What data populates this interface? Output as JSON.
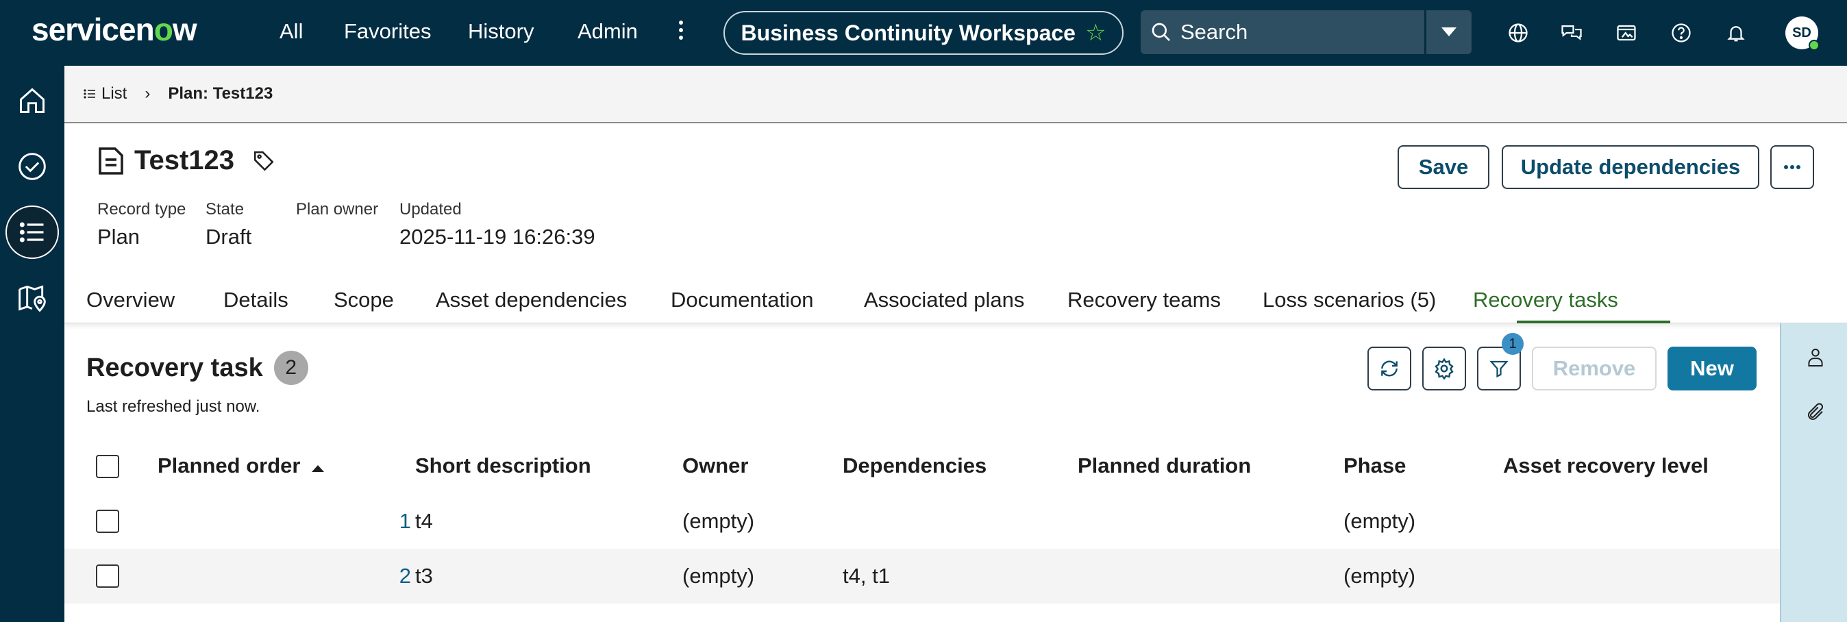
{
  "topbar": {
    "logo_prefix": "servicen",
    "logo_o": "o",
    "logo_suffix": "w",
    "nav": [
      "All",
      "Favorites",
      "History",
      "Admin"
    ],
    "workspace": "Business Continuity Workspace",
    "search_placeholder": "Search",
    "avatar_initials": "SD",
    "icons": [
      "globe-icon",
      "chat-icon",
      "media-icon",
      "help-icon",
      "bell-icon"
    ]
  },
  "rail": {
    "icons": [
      "home-icon",
      "check-circle-icon",
      "list-icon",
      "map-pin-icon"
    ],
    "active": "list-icon"
  },
  "breadcrumb": {
    "list_label": "List",
    "current": "Plan: Test123"
  },
  "record": {
    "title": "Test123",
    "fields": [
      {
        "label": "Record type",
        "value": "Plan"
      },
      {
        "label": "State",
        "value": "Draft"
      },
      {
        "label": "Plan owner",
        "value": ""
      },
      {
        "label": "Updated",
        "value": "2025-11-19 16:26:39"
      }
    ],
    "actions": {
      "save": "Save",
      "update_dependencies": "Update dependencies"
    }
  },
  "tabs": [
    "Overview",
    "Details",
    "Scope",
    "Asset dependencies",
    "Documentation",
    "Associated plans",
    "Recovery teams",
    "Loss scenarios (5)",
    "Recovery tasks"
  ],
  "active_tab": "Recovery tasks",
  "related_list": {
    "title": "Recovery task",
    "count": "2",
    "refreshed": "Last refreshed just now.",
    "filter_count": "1",
    "remove_label": "Remove",
    "new_label": "New",
    "columns": [
      "Planned order",
      "Short description",
      "Owner",
      "Dependencies",
      "Planned duration",
      "Phase",
      "Asset recovery level"
    ],
    "rows": [
      {
        "order": "1",
        "short_description": "t4",
        "owner": "(empty)",
        "dependencies": "",
        "planned_duration": "",
        "phase": "(empty)",
        "asset_recovery_level": ""
      },
      {
        "order": "2",
        "short_description": "t3",
        "owner": "(empty)",
        "dependencies": "t4, t1",
        "planned_duration": "",
        "phase": "(empty)",
        "asset_recovery_level": ""
      }
    ]
  },
  "colors": {
    "header_bg": "#032d42",
    "brand_green": "#62d84e",
    "primary_button": "#1378a1",
    "active_tab": "#2e6e28",
    "side_panel": "#cfe6ee"
  }
}
